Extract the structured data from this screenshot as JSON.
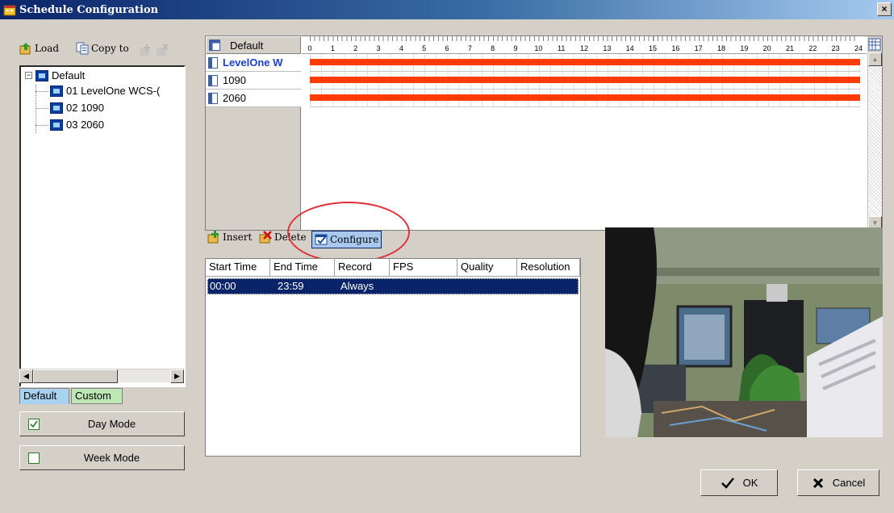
{
  "window": {
    "title": "Schedule Configuration",
    "close_glyph": "×"
  },
  "toolbar": {
    "load_label": "Load",
    "copy_to_label": "Copy to"
  },
  "tree": {
    "root": {
      "label": "Default",
      "expander": "−"
    },
    "items": [
      {
        "label": "01 LevelOne WCS-("
      },
      {
        "label": "02 1090"
      },
      {
        "label": "03 2060"
      }
    ]
  },
  "tabs": {
    "default_label": "Default",
    "custom_label": "Custom"
  },
  "modes": {
    "day_label": "Day Mode",
    "week_label": "Week Mode",
    "day_checked": true,
    "week_checked": false
  },
  "schedule": {
    "header_label": "Default",
    "hours": [
      "0",
      "1",
      "2",
      "3",
      "4",
      "5",
      "6",
      "7",
      "8",
      "9",
      "10",
      "11",
      "12",
      "13",
      "14",
      "15",
      "16",
      "17",
      "18",
      "19",
      "20",
      "21",
      "22",
      "23",
      "24"
    ],
    "rows": [
      {
        "label": "LevelOne W",
        "selected": true
      },
      {
        "label": "1090",
        "selected": false
      },
      {
        "label": "2060",
        "selected": false
      }
    ],
    "bar_color": "#ff3b00"
  },
  "actions": {
    "insert_label": "Insert",
    "delete_label": "Delete",
    "configure_label": "Configure"
  },
  "list": {
    "columns": [
      "Start Time",
      "End Time",
      "Record",
      "FPS",
      "Quality",
      "Resolution"
    ],
    "rows": [
      {
        "start": "00:00",
        "end": "23:59",
        "record": "Always",
        "fps": "",
        "quality": "",
        "resolution": ""
      }
    ]
  },
  "buttons": {
    "ok_label": "OK",
    "cancel_label": "Cancel"
  },
  "colors": {
    "selection": "#0a246a",
    "accent_annotation": "#e0303a"
  }
}
